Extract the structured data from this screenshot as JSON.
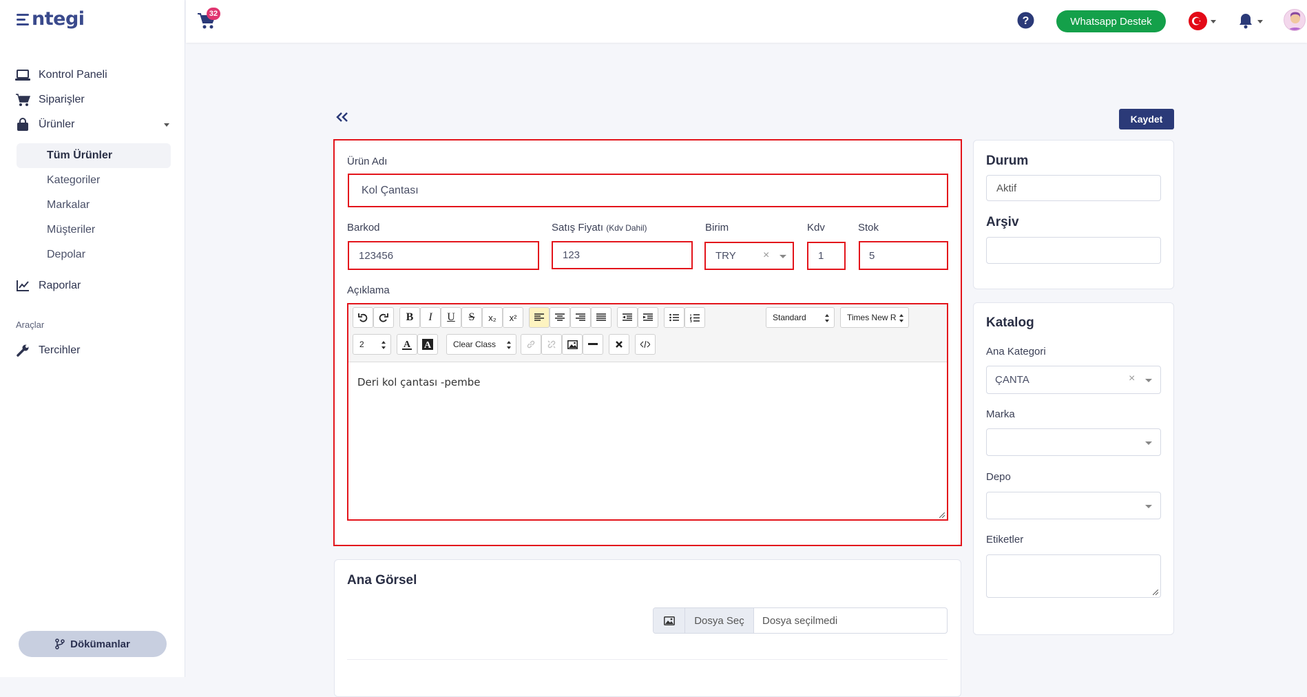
{
  "brand": {
    "logo_text": "ntegi"
  },
  "sidebar": {
    "items": [
      {
        "label": "Kontrol Paneli"
      },
      {
        "label": "Siparişler"
      },
      {
        "label": "Ürünler"
      }
    ],
    "sub_items": [
      {
        "label": "Tüm Ürünler",
        "active": true
      },
      {
        "label": "Kategoriler"
      },
      {
        "label": "Markalar"
      },
      {
        "label": "Müşteriler"
      },
      {
        "label": "Depolar"
      }
    ],
    "reports_label": "Raporlar",
    "tools_section": "Araçlar",
    "prefs_label": "Tercihler",
    "docs_button": "Dökümanlar"
  },
  "topbar": {
    "cart_count": "32",
    "whatsapp_label": "Whatsapp Destek",
    "language_flag": "turkey-flag",
    "accent": "#14a04a"
  },
  "page": {
    "save_label": "Kaydet"
  },
  "product": {
    "name_label": "Ürün Adı",
    "name_value": "Kol Çantası",
    "barcode_label": "Barkod",
    "barcode_value": "123456",
    "price_label": "Satış Fiyatı",
    "price_note": "(Kdv Dahil)",
    "price_value": "123",
    "unit_label": "Birim",
    "unit_value": "TRY",
    "vat_label": "Kdv",
    "vat_value": "1",
    "stock_label": "Stok",
    "stock_value": "5",
    "desc_label": "Açıklama",
    "desc_value": "Deri kol çantası -pembe"
  },
  "editor_toolbar": {
    "bold": "B",
    "italic": "I",
    "underline": "U",
    "strike": "S",
    "subscript": "x₂",
    "superscript": "x²",
    "style_select": "Standard",
    "font_select": "Times New R",
    "size_select": "2",
    "class_select": "Clear Class"
  },
  "main_image": {
    "title": "Ana Görsel",
    "choose_label": "Dosya Seç",
    "no_file": "Dosya seçilmedi"
  },
  "status_card": {
    "status_title": "Durum",
    "status_value": "Aktif",
    "archive_title": "Arşiv",
    "archive_value": ""
  },
  "catalog_card": {
    "title": "Katalog",
    "main_cat_label": "Ana Kategori",
    "main_cat_value": "ÇANTA",
    "brand_label": "Marka",
    "warehouse_label": "Depo",
    "tags_label": "Etiketler"
  },
  "colors": {
    "primary": "#2b3a78",
    "highlight_border": "#e3141b",
    "badge": "#e03670"
  }
}
